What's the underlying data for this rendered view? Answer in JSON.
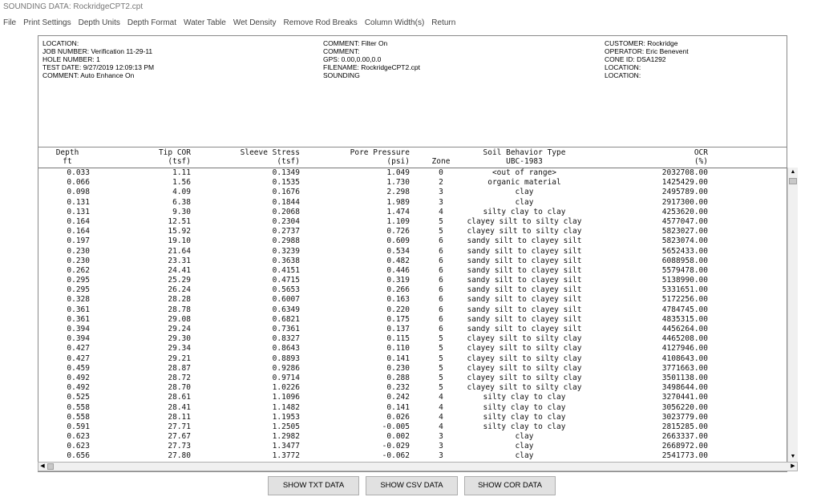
{
  "window": {
    "title": "SOUNDING DATA: RockridgeCPT2.cpt"
  },
  "menu": [
    "File",
    "Print Settings",
    "Depth Units",
    "Depth Format",
    "Water Table",
    "Wet Density",
    "Remove Rod Breaks",
    "Column Width(s)",
    "Return"
  ],
  "header": {
    "left": [
      "LOCATION:",
      "JOB NUMBER: Verification 11-29-11",
      "HOLE NUMBER: 1",
      "TEST DATE: 9/27/2019 12:09:13 PM",
      "COMMENT: Auto Enhance On"
    ],
    "middle": [
      "COMMENT: Filter On",
      "COMMENT:",
      "GPS: 0.00,0.00,0.0",
      "FILENAME: RockridgeCPT2.cpt",
      "SOUNDING"
    ],
    "right": [
      "CUSTOMER: Rockridge",
      "OPERATOR: Eric Benevent",
      "CONE ID: DSA1292",
      "LOCATION:",
      "LOCATION:"
    ]
  },
  "columns": {
    "depth": [
      "Depth",
      "ft"
    ],
    "tip": [
      "Tip COR",
      "(tsf)"
    ],
    "sleeve": [
      "Sleeve Stress",
      "(tsf)"
    ],
    "pore": [
      "Pore Pressure",
      "(psi)"
    ],
    "zone": [
      "",
      "Zone"
    ],
    "soil": [
      "Soil Behavior Type",
      "UBC-1983"
    ],
    "ocr": [
      "OCR",
      "(%)"
    ]
  },
  "rows": [
    [
      "0.033",
      "1.11",
      "0.1349",
      "1.049",
      "0",
      "<out of range>",
      "2032708.00"
    ],
    [
      "0.066",
      "1.56",
      "0.1535",
      "1.730",
      "2",
      "organic material",
      "1425429.00"
    ],
    [
      "0.098",
      "4.09",
      "0.1676",
      "2.298",
      "3",
      "clay",
      "2495789.00"
    ],
    [
      "0.131",
      "6.38",
      "0.1844",
      "1.989",
      "3",
      "clay",
      "2917300.00"
    ],
    [
      "0.131",
      "9.30",
      "0.2068",
      "1.474",
      "4",
      "silty clay to clay",
      "4253620.00"
    ],
    [
      "0.164",
      "12.51",
      "0.2304",
      "1.109",
      "5",
      "clayey silt to silty clay",
      "4577047.00"
    ],
    [
      "0.164",
      "15.92",
      "0.2737",
      "0.726",
      "5",
      "clayey silt to silty clay",
      "5823027.00"
    ],
    [
      "0.197",
      "19.10",
      "0.2988",
      "0.609",
      "6",
      "sandy silt to clayey silt",
      "5823074.00"
    ],
    [
      "0.230",
      "21.64",
      "0.3239",
      "0.534",
      "6",
      "sandy silt to clayey silt",
      "5652433.00"
    ],
    [
      "0.230",
      "23.31",
      "0.3638",
      "0.482",
      "6",
      "sandy silt to clayey silt",
      "6088958.00"
    ],
    [
      "0.262",
      "24.41",
      "0.4151",
      "0.446",
      "6",
      "sandy silt to clayey silt",
      "5579478.00"
    ],
    [
      "0.295",
      "25.29",
      "0.4715",
      "0.319",
      "6",
      "sandy silt to clayey silt",
      "5138990.00"
    ],
    [
      "0.295",
      "26.24",
      "0.5653",
      "0.266",
      "6",
      "sandy silt to clayey silt",
      "5331651.00"
    ],
    [
      "0.328",
      "28.28",
      "0.6007",
      "0.163",
      "6",
      "sandy silt to clayey silt",
      "5172256.00"
    ],
    [
      "0.361",
      "28.78",
      "0.6349",
      "0.220",
      "6",
      "sandy silt to clayey silt",
      "4784745.00"
    ],
    [
      "0.361",
      "29.08",
      "0.6821",
      "0.175",
      "6",
      "sandy silt to clayey silt",
      "4835315.00"
    ],
    [
      "0.394",
      "29.24",
      "0.7361",
      "0.137",
      "6",
      "sandy silt to clayey silt",
      "4456264.00"
    ],
    [
      "0.394",
      "29.30",
      "0.8327",
      "0.115",
      "5",
      "clayey silt to silty clay",
      "4465208.00"
    ],
    [
      "0.427",
      "29.34",
      "0.8643",
      "0.110",
      "5",
      "clayey silt to silty clay",
      "4127946.00"
    ],
    [
      "0.427",
      "29.21",
      "0.8893",
      "0.141",
      "5",
      "clayey silt to silty clay",
      "4108643.00"
    ],
    [
      "0.459",
      "28.87",
      "0.9286",
      "0.230",
      "5",
      "clayey silt to silty clay",
      "3771663.00"
    ],
    [
      "0.492",
      "28.72",
      "0.9714",
      "0.288",
      "5",
      "clayey silt to silty clay",
      "3501138.00"
    ],
    [
      "0.492",
      "28.70",
      "1.0226",
      "0.232",
      "5",
      "clayey silt to silty clay",
      "3498644.00"
    ],
    [
      "0.525",
      "28.61",
      "1.1096",
      "0.242",
      "4",
      "silty clay to clay",
      "3270441.00"
    ],
    [
      "0.558",
      "28.41",
      "1.1482",
      "0.141",
      "4",
      "silty clay to clay",
      "3056220.00"
    ],
    [
      "0.558",
      "28.11",
      "1.1953",
      "0.026",
      "4",
      "silty clay to clay",
      "3023779.00"
    ],
    [
      "0.591",
      "27.71",
      "1.2505",
      "-0.005",
      "4",
      "silty clay to clay",
      "2815285.00"
    ],
    [
      "0.623",
      "27.67",
      "1.2982",
      "0.002",
      "3",
      "clay",
      "2663337.00"
    ],
    [
      "0.623",
      "27.73",
      "1.3477",
      "-0.029",
      "3",
      "clay",
      "2668972.00"
    ],
    [
      "0.656",
      "27.80",
      "1.3772",
      "-0.062",
      "3",
      "clay",
      "2541773.00"
    ]
  ],
  "buttons": {
    "txt": "SHOW TXT DATA",
    "csv": "SHOW CSV DATA",
    "cor": "SHOW COR DATA"
  },
  "icons": {
    "scroll_up": "triangle-up-icon",
    "scroll_down": "triangle-down-icon",
    "scroll_left": "triangle-left-icon",
    "scroll_right": "triangle-right-icon"
  }
}
